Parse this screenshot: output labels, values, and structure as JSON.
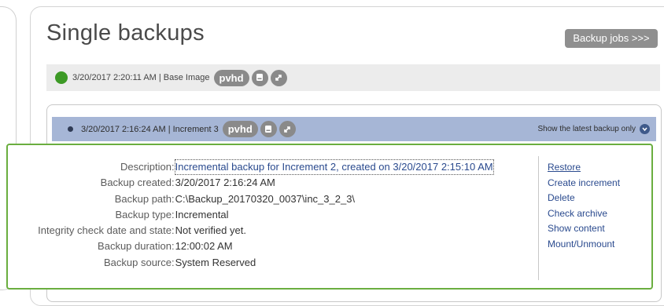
{
  "page": {
    "title": "Single backups",
    "jobs_button": "Backup jobs >>>"
  },
  "base_backup": {
    "summary": "3/20/2017 2:20:11 AM | Base Image",
    "format": "pvhd",
    "status_color": "#3d9a26"
  },
  "increment": {
    "summary": "3/20/2017 2:16:24 AM | Increment 3",
    "format": "pvhd",
    "show_latest_label": "Show the latest backup only"
  },
  "details": [
    {
      "label": "Description",
      "value": "Incremental backup for Increment 2, created on 3/20/2017 2:15:10 AM"
    },
    {
      "label": "Backup created",
      "value": "3/20/2017 2:16:24 AM"
    },
    {
      "label": "Backup path",
      "value": "C:\\Backup_20170320_0037\\inc_3_2_3\\"
    },
    {
      "label": "Backup type",
      "value": "Incremental"
    },
    {
      "label": "Integrity check date and state",
      "value": "Not verified yet."
    },
    {
      "label": "Backup duration",
      "value": "12:00:02 AM"
    },
    {
      "label": "Backup source",
      "value": "System Reserved"
    }
  ],
  "actions": [
    "Restore",
    "Create increment",
    "Delete",
    "Check archive",
    "Show content",
    "Mount/Unmount"
  ],
  "icons": {
    "disk": "disk-icon",
    "expand": "expand-icon",
    "chevron": "chevron-down-icon"
  },
  "colors": {
    "accent_green": "#6aae3f",
    "selected_row": "#a6b6d6",
    "link": "#2a4a8e"
  }
}
